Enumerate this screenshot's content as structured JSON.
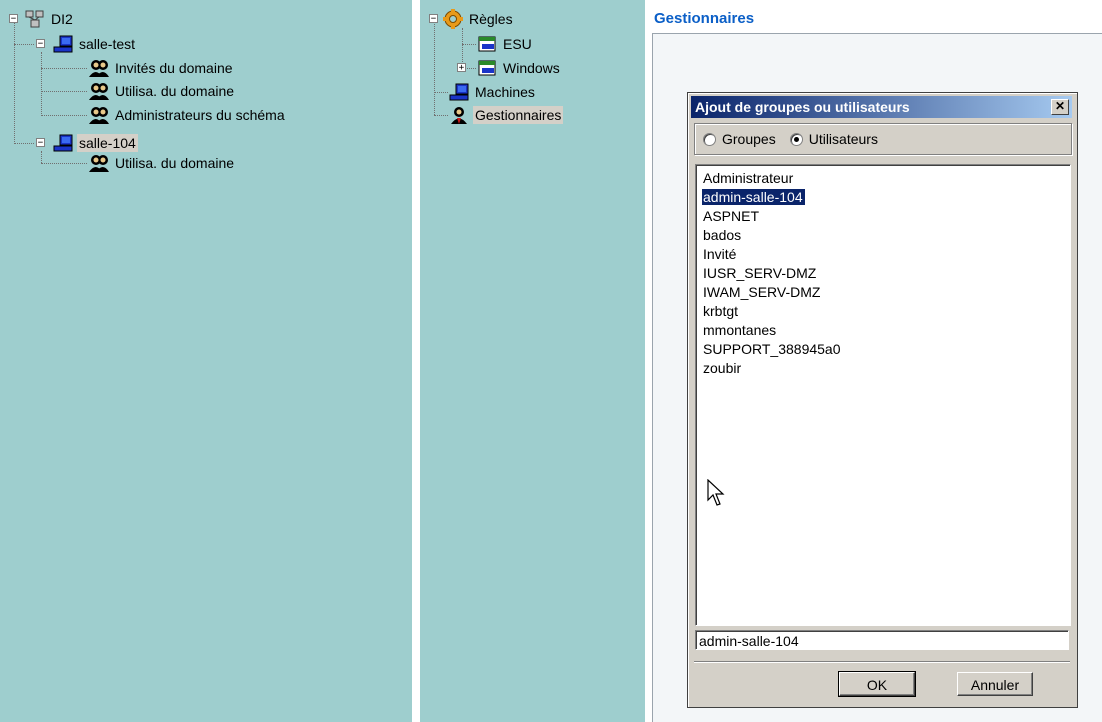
{
  "left_tree": {
    "root": "DI2",
    "groups": [
      {
        "label": "salle-test",
        "children": [
          "Invités du domaine",
          "Utilisa. du domaine",
          "Administrateurs du schéma"
        ]
      },
      {
        "label": "salle-104",
        "children": [
          "Utilisa. du domaine"
        ]
      }
    ]
  },
  "mid_tree": {
    "rules": "Règles",
    "esu": "ESU",
    "windows": "Windows",
    "machines": "Machines",
    "managers": "Gestionnaires"
  },
  "right": {
    "title": "Gestionnaires"
  },
  "dialog": {
    "title": "Ajout de groupes ou utilisateurs",
    "close_glyph": "✕",
    "radio_groups": "Groupes",
    "radio_users": "Utilisateurs",
    "selected_radio": "Utilisateurs",
    "users": [
      "Administrateur",
      "admin-salle-104",
      "ASPNET",
      "bados",
      "Invité",
      "IUSR_SERV-DMZ",
      "IWAM_SERV-DMZ",
      "krbtgt",
      "mmontanes",
      "SUPPORT_388945a0",
      "zoubir"
    ],
    "selected_user": "admin-salle-104",
    "selection_field": "admin-salle-104",
    "ok": "OK",
    "cancel": "Annuler"
  },
  "colors": {
    "pane_bg": "#9ecece",
    "title_blue": "#0b5fc7",
    "dialog_title_start": "#0a246a",
    "selection": "#0a246a"
  },
  "icons": {
    "domain": "network-domain-icon",
    "computer": "computer-icon",
    "group": "user-group-icon",
    "rules": "gear-rules-icon",
    "policy": "policy-icon",
    "manager": "manager-user-icon"
  }
}
